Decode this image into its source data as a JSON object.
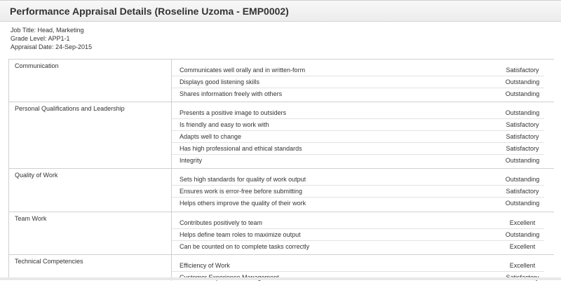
{
  "panel": {
    "title": "Performance Appraisal Details (Roseline Uzoma - EMP0002)"
  },
  "employee": {
    "job_title": "Job Title: Head, Marketing",
    "grade_level": "Grade Level: APP1-1",
    "appraisal_date": "Appraisal Date: 24-Sep-2015"
  },
  "groups": [
    {
      "category": "Communication",
      "rows": [
        {
          "criterion": "Communicates well orally and in written-form",
          "rating": "Satisfactory"
        },
        {
          "criterion": "Displays good listening skills",
          "rating": "Outstanding"
        },
        {
          "criterion": "Shares information freely with others",
          "rating": "Outstanding"
        }
      ]
    },
    {
      "category": "Personal Qualifications and Leadership",
      "rows": [
        {
          "criterion": "Presents a positive image to outsiders",
          "rating": "Outstanding"
        },
        {
          "criterion": "Is friendly and easy to work with",
          "rating": "Satisfactory"
        },
        {
          "criterion": "Adapts well to change",
          "rating": "Satisfactory"
        },
        {
          "criterion": "Has high professional and ethical standards",
          "rating": "Satisfactory"
        },
        {
          "criterion": "Integrity",
          "rating": "Outstanding"
        }
      ]
    },
    {
      "category": "Quality of Work",
      "rows": [
        {
          "criterion": "Sets high standards for quality of work output",
          "rating": "Outstanding"
        },
        {
          "criterion": "Ensures work is error-free before submitting",
          "rating": "Satisfactory"
        },
        {
          "criterion": "Helps others improve the quality of their work",
          "rating": "Outstanding"
        }
      ]
    },
    {
      "category": "Team Work",
      "rows": [
        {
          "criterion": "Contributes positively to team",
          "rating": "Excellent"
        },
        {
          "criterion": "Helps define team roles to maximize output",
          "rating": "Outstanding"
        },
        {
          "criterion": "Can be counted on to complete tasks correctly",
          "rating": "Excellent"
        }
      ]
    },
    {
      "category": "Technical Competencies",
      "rows": [
        {
          "criterion": "Efficiency of Work",
          "rating": "Excellent"
        },
        {
          "criterion": "Customer Experience Management",
          "rating": "Satisfactory"
        }
      ]
    }
  ]
}
